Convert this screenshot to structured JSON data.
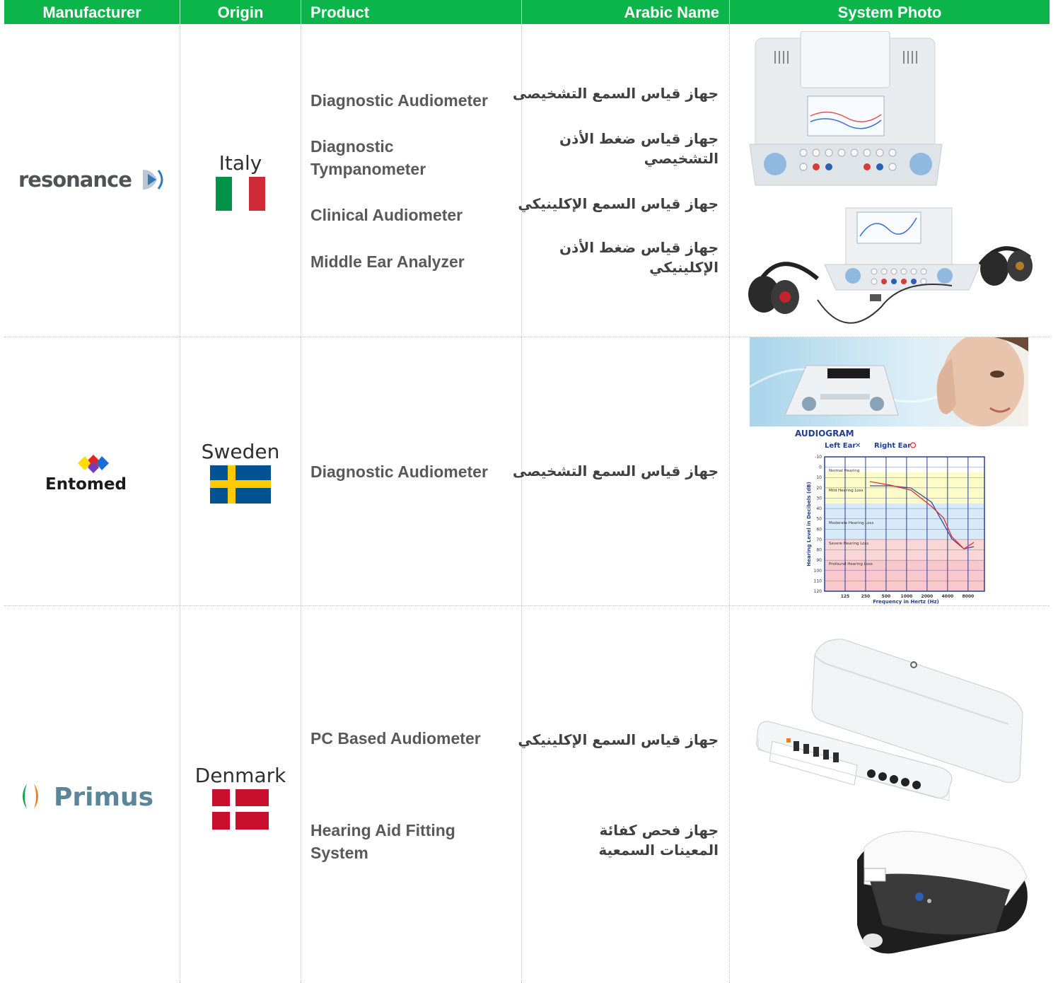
{
  "columns": [
    "Manufacturer",
    "Origin",
    "Product",
    "Arabic Name",
    "System Photo"
  ],
  "rows": [
    {
      "manufacturer": "resonance",
      "origin": "Italy",
      "products": [
        "Diagnostic Audiometer",
        "Diagnostic Tympanometer",
        "Clinical Audiometer",
        "Middle Ear Analyzer"
      ],
      "arabic": [
        "جهاز قياس السمع التشخيصى",
        "جهاز قياس ضغط الأذن التشخيصي",
        "جهاز قياس السمع الإكلينيكي",
        "جهاز قياس ضغط الأذن الإكلينيكي"
      ]
    },
    {
      "manufacturer": "Entomed",
      "origin": "Sweden",
      "products": [
        "Diagnostic Audiometer"
      ],
      "arabic": [
        "جهاز قياس السمع التشخيصى"
      ],
      "audiogram": {
        "title": "AUDIOGRAM",
        "left_ear": "Left Ear",
        "right_ear": "Right Ear",
        "ylabel": "Hearing Level in Decibels (dB)",
        "xlabel": "Frequency in Hertz (Hz)",
        "y_ticks": [
          "-10",
          "0",
          "10",
          "20",
          "30",
          "40",
          "50",
          "60",
          "70",
          "80",
          "90",
          "100",
          "110",
          "120"
        ],
        "x_ticks": [
          "125",
          "250",
          "500",
          "1000",
          "2000",
          "4000",
          "8000"
        ],
        "zones": [
          "Normal Hearing",
          "Mild Hearing Loss",
          "Moderate Hearing Loss",
          "Severe Hearing Loss",
          "Profound Hearing Loss"
        ]
      }
    },
    {
      "manufacturer": "Primus",
      "origin": "Denmark",
      "products": [
        "PC Based Audiometer",
        "Hearing Aid Fitting System"
      ],
      "arabic": [
        "جهاز قياس السمع الإكلينيكي",
        "جهاز فحص كفائة المعينات السمعية"
      ]
    }
  ],
  "colors": {
    "header_bg": "#0bb54a",
    "italy": [
      "#009246",
      "#ffffff",
      "#ce2b37"
    ],
    "sweden": [
      "#005293",
      "#fecb00"
    ],
    "denmark": [
      "#c8102e",
      "#ffffff"
    ]
  }
}
